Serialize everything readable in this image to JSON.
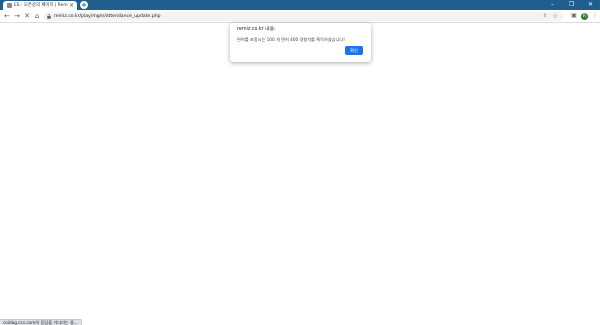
{
  "browser": {
    "tab": {
      "title": "ES : 오픈강의 페이지 | Remic Space",
      "close": "×"
    },
    "new_tab": "+",
    "window_controls": {
      "minimize": "–",
      "maximize": "❐",
      "close": "✕"
    },
    "nav": {
      "back": "←",
      "forward": "→",
      "reload": "✕",
      "home": "⌂"
    },
    "url": "remiz.co.kr/play/mgm/attendance_update.php",
    "profile_initial": "R"
  },
  "alert": {
    "origin": "remiz.co.kr 내용:",
    "message": "면허를 포함시는 100 개 면허 400 경험치를 획득하셨습니다!",
    "ok_label": "확인",
    "accent": "#1a73e8"
  },
  "status_bar": {
    "text": "coidag.ccs.com의 응답을 기다리는 중..."
  },
  "colors": {
    "tab_strip": "#1e5f8f",
    "page_bg": "#ffffff"
  }
}
